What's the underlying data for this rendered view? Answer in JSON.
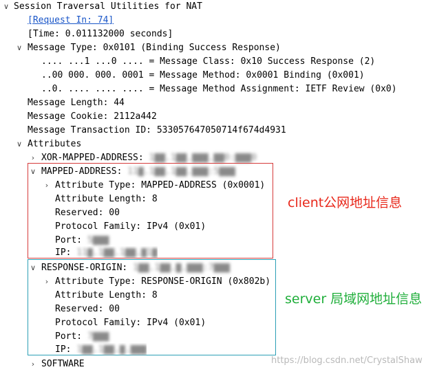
{
  "tree": {
    "root": {
      "label": "Session Traversal Utilities for NAT",
      "toggle": "∨"
    },
    "request_in": "[Request In: 74]",
    "time": "[Time: 0.011132000 seconds]",
    "message_type": {
      "label": "Message Type: 0x0101 (Binding Success Response)",
      "toggle": "∨",
      "class": ".... ...1 ...0 .... = Message Class: 0x10 Success Response (2)",
      "method": "..00 000. 000. 0001 = Message Method: 0x0001 Binding (0x001)",
      "assignment": "..0. .... .... .... = Message Method Assignment: IETF Review (0x0)"
    },
    "message_length": "Message Length: 44",
    "message_cookie": "Message Cookie: 2112a442",
    "transaction_id": "Message Transaction ID: 533057647050714f674d4931",
    "attributes": {
      "label": "Attributes",
      "toggle": "∨",
      "xor_mapped": {
        "toggle": "›",
        "prefix": "XOR-MAPPED-ADDRESS: ",
        "blurred": "1▇▇.1▇▇.▇▇▇.▇▇0:▇▇▇0"
      },
      "mapped": {
        "toggle": "∨",
        "prefix": "MAPPED-ADDRESS: ",
        "blurred": "11▇.1▇▇.1▇▇.▇▇▇:5▇▇▇",
        "type_toggle": "›",
        "type": "Attribute Type: MAPPED-ADDRESS (0x0001)",
        "length": "Attribute Length: 8",
        "reserved": "Reserved: 00",
        "family": "Protocol Family: IPv4 (0x01)",
        "port_prefix": "Port: ",
        "port_blurred": "5▇▇▇",
        "ip_prefix": "IP: ",
        "ip_blurred": "11▇.1▇▇.1▇▇.▇1▇"
      },
      "response_origin": {
        "toggle": "∨",
        "prefix": "RESPONSE-ORIGIN: ",
        "blurred": "1▇▇.1▇▇.▇.▇▇▇:7▇▇▇",
        "type_toggle": "›",
        "type": "Attribute Type: RESPONSE-ORIGIN (0x802b)",
        "length": "Attribute Length: 8",
        "reserved": "Reserved: 00",
        "family": "Protocol Family: IPv4 (0x01)",
        "port_prefix": "Port: ",
        "port_blurred": "7▇▇▇",
        "ip_prefix": "IP: ",
        "ip_blurred": "1▇▇.1▇▇.▇.▇▇▇"
      },
      "software": {
        "toggle": "›",
        "label": "SOFTWARE"
      }
    }
  },
  "annotations": {
    "client": "client公网地址信息",
    "server": "server 局域网地址信息"
  },
  "watermark": "https://blog.csdn.net/CrystalShaw",
  "colors": {
    "link": "#1a56c8",
    "client_box": "#d53a3a",
    "server_box": "#2b9fb5",
    "client_text": "#e8271a",
    "server_text": "#1fae3a"
  }
}
